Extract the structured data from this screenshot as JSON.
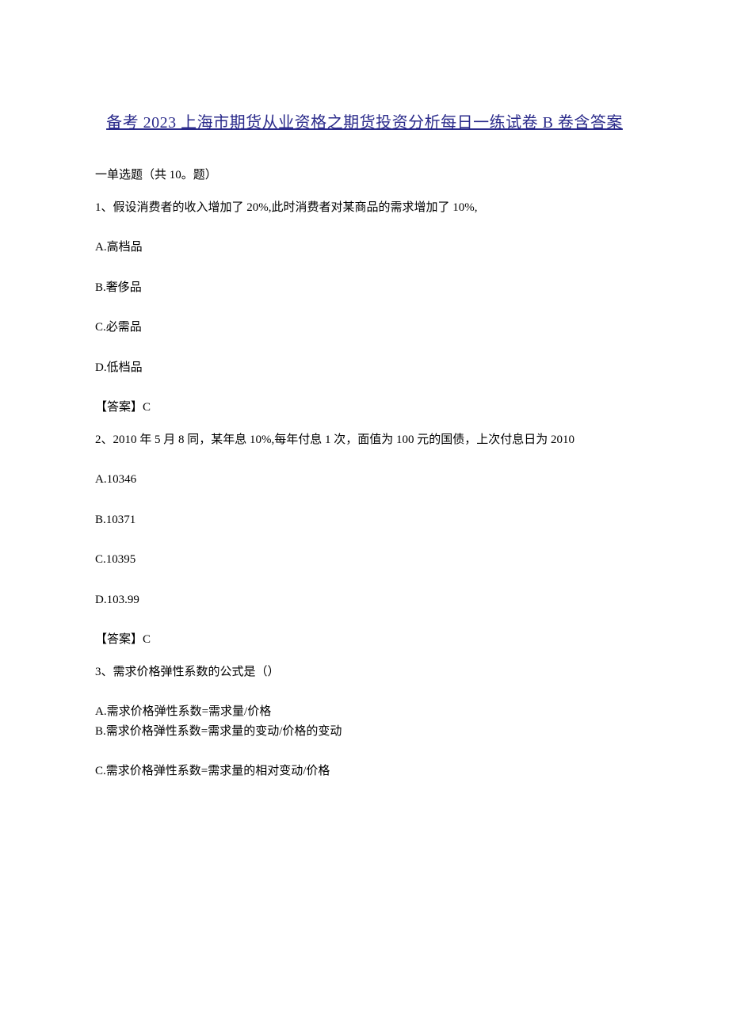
{
  "title": "备考 2023 上海市期货从业资格之期货投资分析每日一练试卷 B 卷含答案",
  "section_label": "一单选题（共 10。题）",
  "questions": [
    {
      "prompt": "1、假设消费者的收入增加了 20%,此时消费者对某商品的需求增加了 10%,",
      "options": [
        "A.高档品",
        "B.奢侈品",
        "C.必需品",
        "D.低档品"
      ],
      "answer": "【答案】C"
    },
    {
      "prompt": "2、2010 年 5 月 8 同，某年息 10%,每年付息 1 次，面值为 100 元的国债，上次付息日为 2010",
      "options": [
        "A.10346",
        "B.10371",
        "C.10395",
        "D.103.99"
      ],
      "answer": "【答案】C"
    },
    {
      "prompt": "3、需求价格弹性系数的公式是（）",
      "options_ab": [
        "A.需求价格弹性系数=需求量/价格",
        "B.需求价格弹性系数=需求量的变动/价格的变动"
      ],
      "option_c": "C.需求价格弹性系数=需求量的相对变动/价格"
    }
  ]
}
